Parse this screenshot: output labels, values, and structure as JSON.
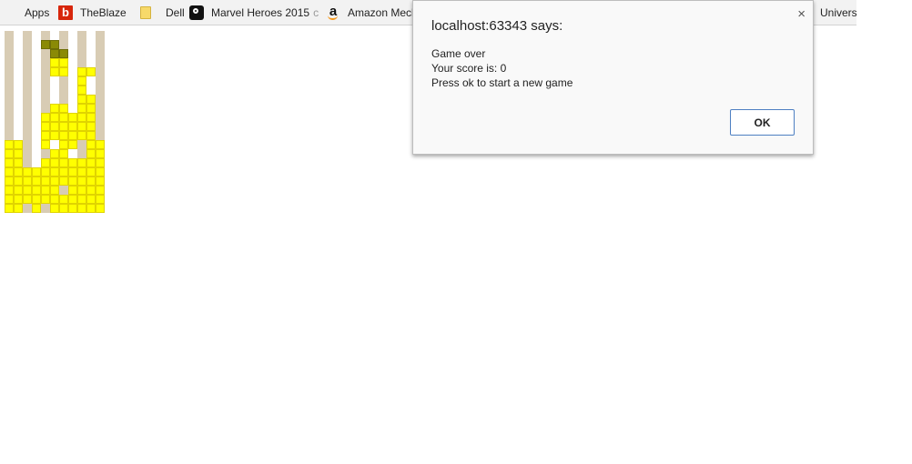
{
  "bookmarks": [
    {
      "label": "Apps",
      "icon": "apps-grid-icon"
    },
    {
      "label": "TheBlaze",
      "icon": "theblaze-icon"
    },
    {
      "label": "Dell",
      "icon": "folder-icon"
    },
    {
      "label": "Marvel Heroes 2015",
      "icon": "steam-icon",
      "trailing": "c"
    },
    {
      "label": "Amazon Mech",
      "icon": "amazon-icon"
    },
    {
      "label": "Univers"
    }
  ],
  "apps_icon_colors": [
    "#e8453c",
    "#f4b400",
    "#34a853",
    "#4285f4",
    "#e8453c",
    "#f4b400",
    "#34a853",
    "#4285f4",
    "#e8453c"
  ],
  "colors": {
    "block": "#ffff00",
    "active_block": "#8a8a06",
    "column_bg": "#d8ccb4",
    "ok_border": "#4d7fc2"
  },
  "game": {
    "columns": 11,
    "rows": 20,
    "column_tracks": [
      0,
      2,
      4,
      6,
      8,
      10
    ],
    "filled_cells": [
      [
        0,
        12
      ],
      [
        0,
        13
      ],
      [
        0,
        14
      ],
      [
        0,
        15
      ],
      [
        0,
        16
      ],
      [
        0,
        17
      ],
      [
        0,
        18
      ],
      [
        0,
        19
      ],
      [
        1,
        12
      ],
      [
        1,
        13
      ],
      [
        1,
        14
      ],
      [
        1,
        15
      ],
      [
        1,
        16
      ],
      [
        1,
        17
      ],
      [
        1,
        18
      ],
      [
        1,
        19
      ],
      [
        2,
        15
      ],
      [
        2,
        16
      ],
      [
        2,
        17
      ],
      [
        2,
        18
      ],
      [
        3,
        15
      ],
      [
        3,
        16
      ],
      [
        3,
        17
      ],
      [
        3,
        18
      ],
      [
        3,
        19
      ],
      [
        4,
        9
      ],
      [
        4,
        10
      ],
      [
        4,
        11
      ],
      [
        4,
        12
      ],
      [
        4,
        14
      ],
      [
        4,
        15
      ],
      [
        4,
        16
      ],
      [
        4,
        17
      ],
      [
        4,
        18
      ],
      [
        5,
        3
      ],
      [
        5,
        4
      ],
      [
        5,
        8
      ],
      [
        5,
        9
      ],
      [
        5,
        10
      ],
      [
        5,
        11
      ],
      [
        5,
        13
      ],
      [
        5,
        14
      ],
      [
        5,
        15
      ],
      [
        5,
        16
      ],
      [
        5,
        17
      ],
      [
        5,
        18
      ],
      [
        5,
        19
      ],
      [
        6,
        3
      ],
      [
        6,
        4
      ],
      [
        6,
        8
      ],
      [
        6,
        9
      ],
      [
        6,
        10
      ],
      [
        6,
        11
      ],
      [
        6,
        12
      ],
      [
        6,
        13
      ],
      [
        6,
        14
      ],
      [
        6,
        15
      ],
      [
        6,
        16
      ],
      [
        6,
        18
      ],
      [
        6,
        19
      ],
      [
        7,
        9
      ],
      [
        7,
        10
      ],
      [
        7,
        11
      ],
      [
        7,
        12
      ],
      [
        7,
        14
      ],
      [
        7,
        15
      ],
      [
        7,
        16
      ],
      [
        7,
        17
      ],
      [
        7,
        18
      ],
      [
        7,
        19
      ],
      [
        8,
        4
      ],
      [
        8,
        5
      ],
      [
        8,
        6
      ],
      [
        8,
        7
      ],
      [
        8,
        8
      ],
      [
        8,
        9
      ],
      [
        8,
        10
      ],
      [
        8,
        11
      ],
      [
        8,
        14
      ],
      [
        8,
        15
      ],
      [
        8,
        16
      ],
      [
        8,
        17
      ],
      [
        8,
        18
      ],
      [
        8,
        19
      ],
      [
        9,
        4
      ],
      [
        9,
        7
      ],
      [
        9,
        8
      ],
      [
        9,
        9
      ],
      [
        9,
        10
      ],
      [
        9,
        11
      ],
      [
        9,
        12
      ],
      [
        9,
        13
      ],
      [
        9,
        14
      ],
      [
        9,
        15
      ],
      [
        9,
        16
      ],
      [
        9,
        17
      ],
      [
        9,
        18
      ],
      [
        9,
        19
      ],
      [
        10,
        12
      ],
      [
        10,
        13
      ],
      [
        10,
        14
      ],
      [
        10,
        15
      ],
      [
        10,
        16
      ],
      [
        10,
        17
      ],
      [
        10,
        18
      ],
      [
        10,
        19
      ]
    ],
    "active_cells": [
      [
        4,
        1
      ],
      [
        5,
        1
      ],
      [
        5,
        2
      ],
      [
        6,
        2
      ]
    ]
  },
  "dialog": {
    "title": "localhost:63343 says:",
    "close_symbol": "×",
    "message_lines": [
      "Game over",
      "Your score is: 0",
      "Press ok to start a new game"
    ],
    "ok_label": "OK"
  }
}
